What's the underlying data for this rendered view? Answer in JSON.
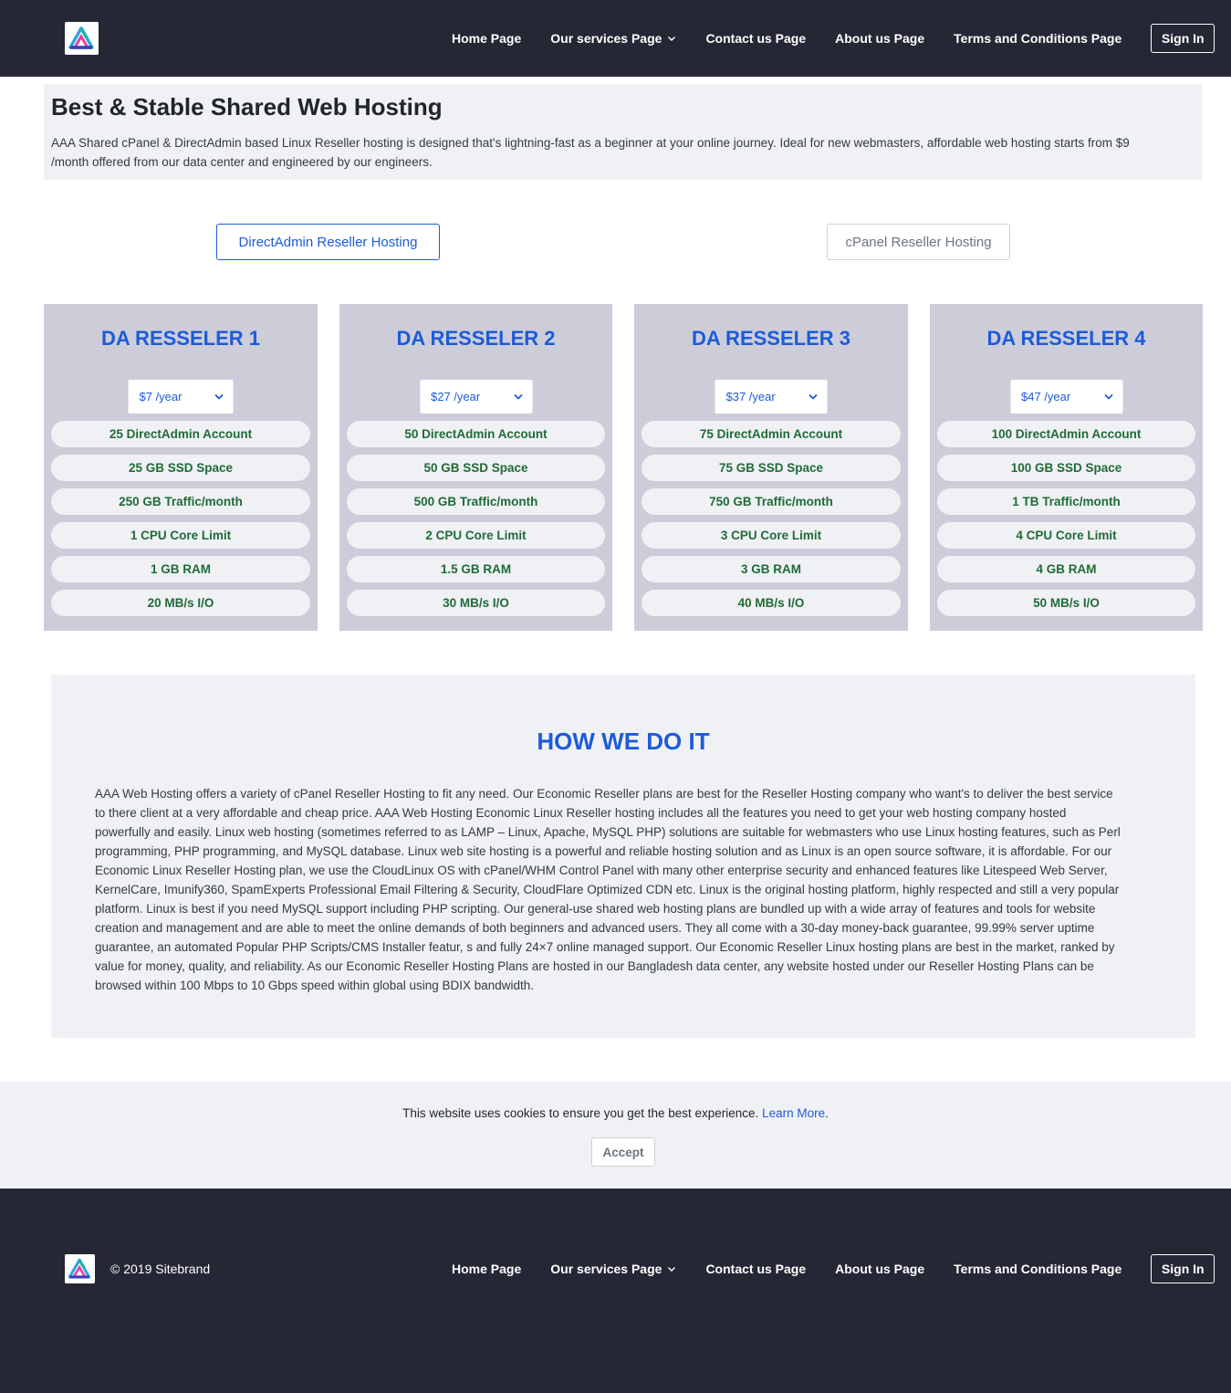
{
  "header": {
    "nav": [
      "Home Page",
      "Our services Page",
      "Contact us Page",
      "About us Page",
      "Terms and Conditions Page"
    ],
    "signin": "Sign In"
  },
  "hero": {
    "title": "Best & Stable Shared Web Hosting",
    "desc_line1": "AAA Shared cPanel & DirectAdmin based Linux Reseller hosting is designed that's lightning-fast as a beginner at your online journey. Ideal for new webmasters, affordable web hosting starts from $9",
    "desc_line2": "/month offered from our data center and engineered by our engineers."
  },
  "tabs": {
    "directadmin": "DirectAdmin Reseller Hosting",
    "cpanel": "cPanel Reseller Hosting"
  },
  "plans": [
    {
      "title": "DA RESSELER 1",
      "price": "$7 /year",
      "features": [
        "25 DirectAdmin Account",
        "25 GB SSD Space",
        "250 GB Traffic/month",
        "1 CPU Core Limit",
        "1 GB RAM",
        "20 MB/s I/O"
      ]
    },
    {
      "title": "DA RESSELER 2",
      "price": "$27 /year",
      "features": [
        "50 DirectAdmin Account",
        "50 GB SSD Space",
        "500 GB Traffic/month",
        "2 CPU Core Limit",
        "1.5 GB RAM",
        "30 MB/s I/O"
      ]
    },
    {
      "title": "DA RESSELER 3",
      "price": "$37 /year",
      "features": [
        "75 DirectAdmin Account",
        "75 GB SSD Space",
        "750 GB Traffic/month",
        "3 CPU Core Limit",
        "3 GB RAM",
        "40 MB/s I/O"
      ]
    },
    {
      "title": "DA RESSELER 4",
      "price": "$47 /year",
      "features": [
        "100 DirectAdmin Account",
        "100 GB SSD Space",
        "1 TB Traffic/month",
        "4 CPU Core Limit",
        "4 GB RAM",
        "50 MB/s I/O"
      ]
    }
  ],
  "how": {
    "title": "HOW WE DO IT",
    "lines": [
      "AAA Web Hosting offers a variety of cPanel Reseller Hosting to fit any need. Our Economic Reseller plans are best for the Reseller Hosting company who want's to deliver the best service",
      "to there client at a very affordable and cheap price. AAA Web Hosting Economic Linux Reseller hosting includes all the features you need to get your web hosting company hosted",
      "powerfully and easily. Linux web hosting (sometimes referred to as LAMP – Linux, Apache, MySQL PHP) solutions are suitable for webmasters who use Linux hosting features, such as Perl",
      "programming, PHP programming, and MySQL database. Linux web site hosting is a powerful and reliable hosting solution and as Linux is an open source software, it is affordable. For our",
      "Economic Linux Reseller Hosting plan, we use the CloudLinux OS with cPanel/WHM Control Panel with many other enterprise security and enhanced features like Litespeed Web Server,",
      "KernelCare, Imunify360, SpamExperts Professional Email Filtering & Security, CloudFlare Optimized CDN etc. Linux is the original hosting platform, highly respected and still a very popular",
      "platform. Linux is best if you need MySQL support including PHP scripting. Our general-use shared web hosting plans are bundled up with a wide array of features and tools for website",
      "creation and management and are able to meet the online demands of both beginners and advanced users. They all come with a 30-day money-back guarantee, 99.99% server uptime",
      "guarantee, an automated Popular PHP Scripts/CMS Installer featur, s and fully 24×7 online managed support. Our Economic Reseller Linux hosting plans are best in the market, ranked by",
      "value for money, quality, and reliability. As our Economic Reseller Hosting Plans are hosted in our Bangladesh data center, any website hosted under our Reseller Hosting Plans can be",
      "browsed within 100 Mbps to 10 Gbps speed within global using BDIX bandwidth."
    ]
  },
  "cookie": {
    "text": "This website uses cookies to ensure you get the best experience.",
    "link": "Learn More",
    "period": ".",
    "accept": "Accept"
  },
  "footer": {
    "copyright": "© 2019 Sitebrand"
  },
  "colors": {
    "dark": "#262734",
    "accent": "#1c5bd9",
    "feature_text": "#1f6b37",
    "panel": "#f0f1f5",
    "plan_bg": "#cdcdd9"
  }
}
